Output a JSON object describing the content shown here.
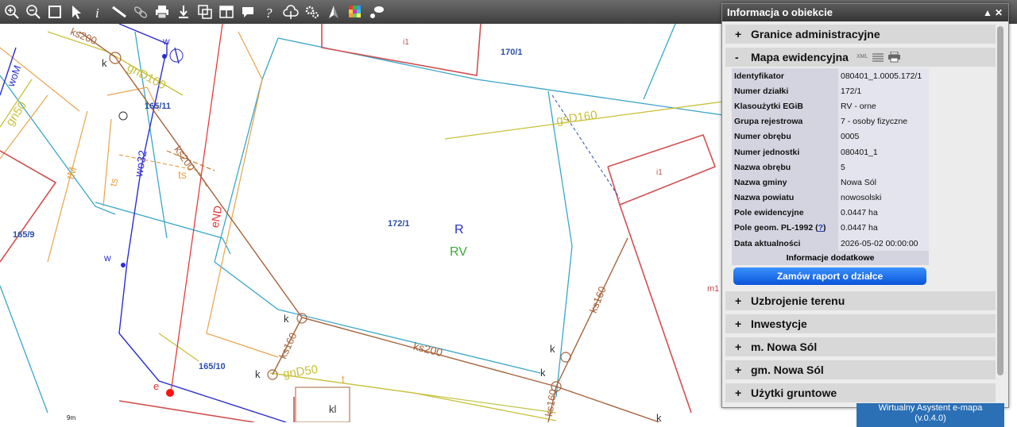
{
  "toolbar": {
    "tools": [
      {
        "name": "zoom-in-icon",
        "glyph": "+"
      },
      {
        "name": "zoom-out-icon",
        "glyph": "−"
      },
      {
        "name": "zoom-extent-icon",
        "glyph": ""
      },
      {
        "name": "select-arrow-icon",
        "glyph": ""
      },
      {
        "name": "info-icon",
        "glyph": "i"
      },
      {
        "name": "measure-distance-icon",
        "glyph": ""
      },
      {
        "name": "link-icon",
        "glyph": ""
      },
      {
        "name": "print-icon",
        "glyph": ""
      },
      {
        "name": "download-icon",
        "glyph": ""
      },
      {
        "name": "layers-copy-icon",
        "glyph": ""
      },
      {
        "name": "layout-icon",
        "glyph": ""
      },
      {
        "name": "comment-icon",
        "glyph": ""
      },
      {
        "name": "help-icon",
        "glyph": "?"
      },
      {
        "name": "cloud-upload-icon",
        "glyph": ""
      },
      {
        "name": "settings-icon",
        "glyph": ""
      },
      {
        "name": "north-arrow-icon",
        "glyph": ""
      },
      {
        "name": "color-palette-icon",
        "glyph": ""
      },
      {
        "name": "chat-icon",
        "glyph": ""
      }
    ]
  },
  "map": {
    "labels": {
      "ks200_a": "ks200",
      "k_a": "k",
      "gnD100": "gnD100",
      "w_a": "w",
      "p165_11": "165/11",
      "wo32": "wo32",
      "ks200_b": "ks200",
      "woM": "woM",
      "gn50": "gn50",
      "tM": "tM",
      "ts_a": "ts",
      "ts_b": "ts",
      "i1_a": "i1",
      "p170_1": "170/1",
      "gsD160": "gsD160",
      "i1_b": "i1",
      "p172_1": "172/1",
      "R": "R",
      "RV": "RV",
      "eND": "eND",
      "p165_9": "165/9",
      "w_b": "w",
      "ks160_a": "ks160",
      "k_b": "k",
      "ks160_b": "ks160",
      "k_c": "k",
      "ks200_c": "ks200",
      "k_d": "k",
      "k_e": "k",
      "gnD50": "gnD50",
      "t": "t",
      "kl": "kl",
      "p165_10": "165/10",
      "e": "e",
      "m1": "m1",
      "ks160_c": "ks160",
      "k_f": "k",
      "scale": "9m"
    }
  },
  "panel": {
    "title": "Informacja o obiekcie",
    "sections": {
      "granice": {
        "sign": "+",
        "label": "Granice administracyjne"
      },
      "mapa": {
        "sign": "-",
        "label": "Mapa ewidencyjna",
        "xml": "XML"
      },
      "uzbrojenie": {
        "sign": "+",
        "label": "Uzbrojenie terenu"
      },
      "inwestycje": {
        "sign": "+",
        "label": "Inwestycje"
      },
      "miasto": {
        "sign": "+",
        "label": "m. Nowa Sól"
      },
      "gmina": {
        "sign": "+",
        "label": "gm. Nowa Sól"
      },
      "uzytki": {
        "sign": "+",
        "label": "Użytki gruntowe"
      }
    },
    "table": [
      {
        "key": "Identyfikator",
        "value": "080401_1.0005.172/1"
      },
      {
        "key": "Numer działki",
        "value": "172/1"
      },
      {
        "key": "Klasoużytki EGiB",
        "value": "RV - orne"
      },
      {
        "key": "Grupa rejestrowa",
        "value": "7 - osoby fizyczne"
      },
      {
        "key": "Numer obrębu",
        "value": "0005"
      },
      {
        "key": "Numer jednostki",
        "value": "080401_1"
      },
      {
        "key": "Nazwa obrębu",
        "value": "5"
      },
      {
        "key": "Nazwa gminy",
        "value": "Nowa Sól"
      },
      {
        "key": "Nazwa powiatu",
        "value": "nowosolski"
      },
      {
        "key": "Pole ewidencyjne",
        "value": "0.0447 ha"
      },
      {
        "key": "Pole geom. PL-1992",
        "value": "0.0447 ha",
        "help": "?"
      },
      {
        "key": "Data aktualności",
        "value": "2026-05-02 00:00:00"
      }
    ],
    "extra_info": "Informacje dodatkowe",
    "order_button": "Zamów raport o działce"
  },
  "assistant": {
    "line1": "Wirtualny Asystent e-mapa",
    "line2": "(v.0.4.0)"
  }
}
